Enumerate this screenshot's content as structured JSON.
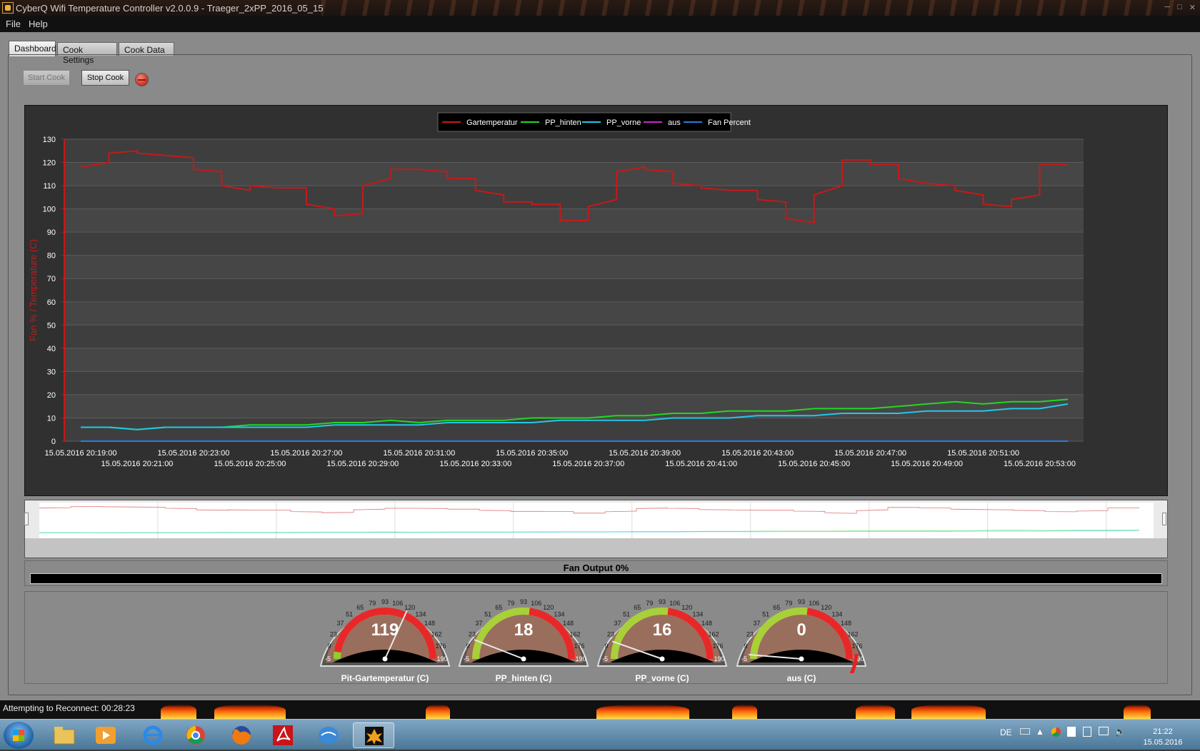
{
  "window": {
    "title": "CyberQ Wifi Temperature Controller v2.0.0.9 - Traeger_2xPP_2016_05_15"
  },
  "menu": [
    "File",
    "Help"
  ],
  "tabs": [
    {
      "label": "Dashboard",
      "active": true
    },
    {
      "label": "Cook Settings",
      "active": false
    },
    {
      "label": "Cook Data",
      "active": false
    }
  ],
  "controls": {
    "start_label": "Start Cook",
    "stop_label": "Stop Cook",
    "start_enabled": false
  },
  "chart_data": {
    "type": "line",
    "ylabel": "Fan % / Temperature (C)",
    "ylim": [
      0,
      130
    ],
    "yticks": [
      0,
      10,
      20,
      30,
      40,
      50,
      60,
      70,
      80,
      90,
      100,
      110,
      120,
      130
    ],
    "xticks_top": [
      "15.05.2016 20:19:00",
      "15.05.2016 20:23:00",
      "15.05.2016 20:27:00",
      "15.05.2016 20:31:00",
      "15.05.2016 20:35:00",
      "15.05.2016 20:39:00",
      "15.05.2016 20:43:00",
      "15.05.2016 20:47:00",
      "15.05.2016 20:51:00"
    ],
    "xticks_bottom": [
      "15.05.2016 20:21:00",
      "15.05.2016 20:25:00",
      "15.05.2016 20:29:00",
      "15.05.2016 20:33:00",
      "15.05.2016 20:37:00",
      "15.05.2016 20:41:00",
      "15.05.2016 20:45:00",
      "15.05.2016 20:49:00",
      "15.05.2016 20:53:00"
    ],
    "x_range_minutes": [
      0,
      35
    ],
    "grid": true,
    "legend_position": "top-center",
    "series": [
      {
        "name": "Gartemperatur",
        "color": "#c81818",
        "points": [
          [
            0,
            118
          ],
          [
            1,
            120
          ],
          [
            1,
            124
          ],
          [
            2,
            125
          ],
          [
            2,
            124
          ],
          [
            3,
            123
          ],
          [
            4,
            122
          ],
          [
            4,
            117
          ],
          [
            5,
            116
          ],
          [
            5,
            110
          ],
          [
            6,
            108
          ],
          [
            6,
            110
          ],
          [
            7,
            109
          ],
          [
            8,
            109
          ],
          [
            8,
            102
          ],
          [
            9,
            100
          ],
          [
            9,
            97
          ],
          [
            10,
            98
          ],
          [
            10,
            110
          ],
          [
            11,
            113
          ],
          [
            11,
            117
          ],
          [
            12,
            117
          ],
          [
            13,
            116
          ],
          [
            13,
            113
          ],
          [
            14,
            113
          ],
          [
            14,
            108
          ],
          [
            15,
            106
          ],
          [
            15,
            103
          ],
          [
            16,
            103
          ],
          [
            16,
            102
          ],
          [
            17,
            102
          ],
          [
            17,
            95
          ],
          [
            18,
            95
          ],
          [
            18,
            101
          ],
          [
            19,
            104
          ],
          [
            19,
            116
          ],
          [
            20,
            118
          ],
          [
            20,
            117
          ],
          [
            21,
            116
          ],
          [
            21,
            111
          ],
          [
            22,
            110
          ],
          [
            22,
            109
          ],
          [
            23,
            108
          ],
          [
            24,
            108
          ],
          [
            24,
            104
          ],
          [
            25,
            103
          ],
          [
            25,
            96
          ],
          [
            26,
            94
          ],
          [
            26,
            106
          ],
          [
            27,
            110
          ],
          [
            27,
            121
          ],
          [
            28,
            121
          ],
          [
            28,
            119
          ],
          [
            29,
            119
          ],
          [
            29,
            113
          ],
          [
            30,
            111
          ],
          [
            31,
            110
          ],
          [
            31,
            108
          ],
          [
            32,
            106
          ],
          [
            32,
            102
          ],
          [
            33,
            101
          ],
          [
            33,
            104
          ],
          [
            34,
            106
          ],
          [
            34,
            119
          ],
          [
            35,
            119
          ]
        ]
      },
      {
        "name": "PP_hinten",
        "color": "#22d822",
        "points": [
          [
            0,
            6
          ],
          [
            1,
            6
          ],
          [
            2,
            5
          ],
          [
            3,
            6
          ],
          [
            4,
            6
          ],
          [
            5,
            6
          ],
          [
            6,
            7
          ],
          [
            7,
            7
          ],
          [
            8,
            7
          ],
          [
            9,
            8
          ],
          [
            10,
            8
          ],
          [
            11,
            9
          ],
          [
            12,
            8
          ],
          [
            13,
            9
          ],
          [
            14,
            9
          ],
          [
            15,
            9
          ],
          [
            16,
            10
          ],
          [
            17,
            10
          ],
          [
            18,
            10
          ],
          [
            19,
            11
          ],
          [
            20,
            11
          ],
          [
            21,
            12
          ],
          [
            22,
            12
          ],
          [
            23,
            13
          ],
          [
            24,
            13
          ],
          [
            25,
            13
          ],
          [
            26,
            14
          ],
          [
            27,
            14
          ],
          [
            28,
            14
          ],
          [
            29,
            15
          ],
          [
            30,
            16
          ],
          [
            31,
            17
          ],
          [
            32,
            16
          ],
          [
            33,
            17
          ],
          [
            34,
            17
          ],
          [
            35,
            18
          ]
        ]
      },
      {
        "name": "PP_vorne",
        "color": "#22c8e8",
        "points": [
          [
            0,
            6
          ],
          [
            1,
            6
          ],
          [
            2,
            5
          ],
          [
            3,
            6
          ],
          [
            4,
            6
          ],
          [
            5,
            6
          ],
          [
            6,
            6
          ],
          [
            7,
            6
          ],
          [
            8,
            6
          ],
          [
            9,
            7
          ],
          [
            10,
            7
          ],
          [
            11,
            7
          ],
          [
            12,
            7
          ],
          [
            13,
            8
          ],
          [
            14,
            8
          ],
          [
            15,
            8
          ],
          [
            16,
            8
          ],
          [
            17,
            9
          ],
          [
            18,
            9
          ],
          [
            19,
            9
          ],
          [
            20,
            9
          ],
          [
            21,
            10
          ],
          [
            22,
            10
          ],
          [
            23,
            10
          ],
          [
            24,
            11
          ],
          [
            25,
            11
          ],
          [
            26,
            11
          ],
          [
            27,
            12
          ],
          [
            28,
            12
          ],
          [
            29,
            12
          ],
          [
            30,
            13
          ],
          [
            31,
            13
          ],
          [
            32,
            13
          ],
          [
            33,
            14
          ],
          [
            34,
            14
          ],
          [
            35,
            16
          ]
        ]
      },
      {
        "name": "aus",
        "color": "#c828c8",
        "points": [
          [
            0,
            0
          ],
          [
            35,
            0
          ]
        ]
      },
      {
        "name": "Fan Percent",
        "color": "#2a7ae8",
        "points": [
          [
            0,
            0
          ],
          [
            35,
            0
          ]
        ]
      }
    ]
  },
  "fan": {
    "label": "Fan Output 0%",
    "value_percent": 0
  },
  "gauges": [
    {
      "label": "Pit-Gartemperatur (C)",
      "value": 119,
      "display": "119",
      "ticks": [
        "-5",
        "9",
        "23",
        "37",
        "51",
        "65",
        "79",
        "93",
        "106",
        "120",
        "134",
        "148",
        "162",
        "176",
        "190"
      ]
    },
    {
      "label": "PP_hinten (C)",
      "value": 18,
      "display": "18",
      "ticks": [
        "-5",
        "9",
        "23",
        "37",
        "51",
        "65",
        "79",
        "93",
        "106",
        "120",
        "134",
        "148",
        "162",
        "176",
        "190"
      ]
    },
    {
      "label": "PP_vorne (C)",
      "value": 16,
      "display": "16",
      "ticks": [
        "-5",
        "9",
        "23",
        "37",
        "51",
        "65",
        "79",
        "93",
        "106",
        "120",
        "134",
        "148",
        "162",
        "176",
        "190"
      ]
    },
    {
      "label": "aus (C)",
      "value": 0,
      "display": "0",
      "ticks": [
        "-5",
        "9",
        "23",
        "37",
        "51",
        "65",
        "79",
        "93",
        "106",
        "120",
        "134",
        "148",
        "162",
        "176",
        "190"
      ]
    }
  ],
  "status": {
    "text": "Attempting to Reconnect: 00:28:23"
  },
  "taskbar": {
    "apps": [
      "explorer-icon",
      "media-player-icon",
      "ie-icon",
      "chrome-icon",
      "firefox-icon",
      "acrobat-icon",
      "mail-icon",
      "cyberq-icon"
    ],
    "lang": "DE",
    "time": "21:22",
    "date": "15.05.2016"
  }
}
